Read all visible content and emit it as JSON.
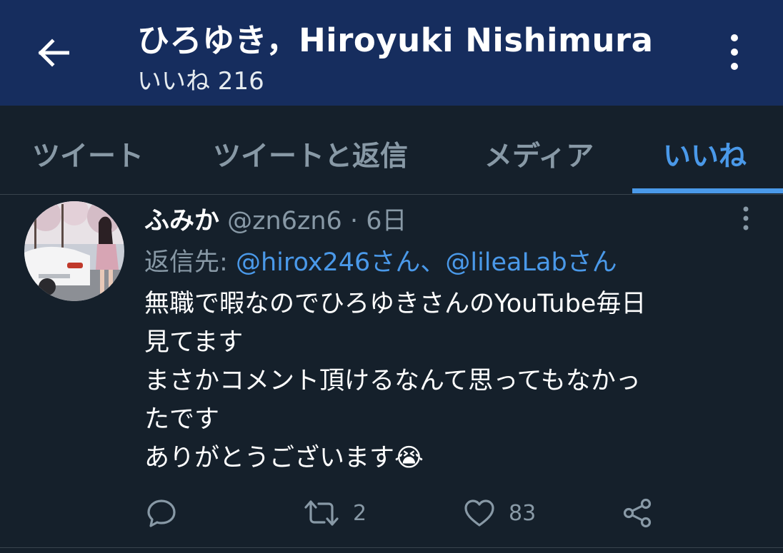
{
  "header": {
    "title": "ひろゆき，Hiroyuki Nishimura",
    "subtitle": "いいね 216",
    "back_icon": "arrow-left-icon",
    "more_icon": "vertical-dots-icon",
    "background_color": "#162d5e"
  },
  "tabs": [
    {
      "label": "ツイート",
      "active": false
    },
    {
      "label": "ツイートと返信",
      "active": false
    },
    {
      "label": "メディア",
      "active": false
    },
    {
      "label": "いいね",
      "active": true
    }
  ],
  "tweet": {
    "author_name": "ふみか",
    "author_handle": "@zn6zn6",
    "separator": "·",
    "time": "6日",
    "reply_label": "返信先:",
    "reply_to": [
      "@hirox246さん",
      "@lileaLabさん"
    ],
    "reply_separator": "、",
    "body_lines": [
      "無職で暇なのでひろゆきさんのYouTube毎日",
      "見てます",
      "まさかコメント頂けるなんて思ってもなかっ",
      "たです",
      "ありがとうございます😭"
    ],
    "actions": {
      "reply_icon": "comment-icon",
      "retweet_icon": "retweet-icon",
      "retweet_count": "2",
      "like_icon": "heart-icon",
      "like_count": "83",
      "share_icon": "share-icon"
    }
  },
  "colors": {
    "background": "#15202b",
    "accent": "#4a99e9",
    "muted": "#8899a6",
    "divider": "#38444d"
  }
}
